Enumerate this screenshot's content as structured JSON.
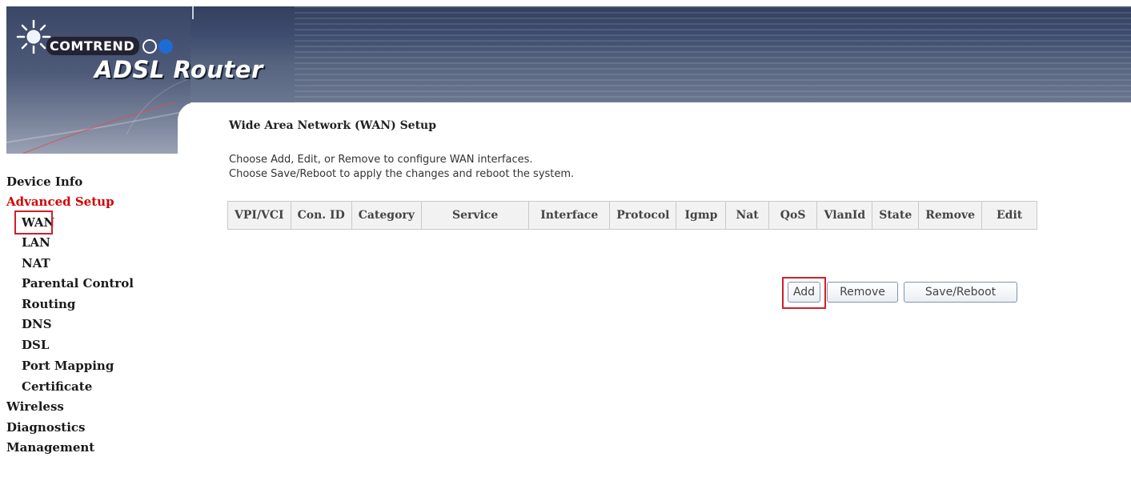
{
  "header": {
    "brand": "COMTREND",
    "product": "ADSL Router"
  },
  "sidebar": {
    "items": [
      {
        "label": "Device Info",
        "level": "top"
      },
      {
        "label": "Advanced Setup",
        "level": "top",
        "active": true
      },
      {
        "label": "WAN",
        "level": "sub",
        "selected": true
      },
      {
        "label": "LAN",
        "level": "sub"
      },
      {
        "label": "NAT",
        "level": "sub"
      },
      {
        "label": "Parental Control",
        "level": "sub"
      },
      {
        "label": "Routing",
        "level": "sub"
      },
      {
        "label": "DNS",
        "level": "sub"
      },
      {
        "label": "DSL",
        "level": "sub"
      },
      {
        "label": "Port Mapping",
        "level": "sub"
      },
      {
        "label": "Certificate",
        "level": "sub"
      },
      {
        "label": "Wireless",
        "level": "top"
      },
      {
        "label": "Diagnostics",
        "level": "top"
      },
      {
        "label": "Management",
        "level": "top"
      }
    ]
  },
  "main": {
    "title": "Wide Area Network (WAN) Setup",
    "instructions": [
      "Choose Add, Edit, or Remove to configure WAN interfaces.",
      "Choose Save/Reboot to apply the changes and reboot the system."
    ],
    "table": {
      "columns": [
        "VPI/VCI",
        "Con. ID",
        "Category",
        "Service",
        "Interface",
        "Protocol",
        "Igmp",
        "Nat",
        "QoS",
        "VlanId",
        "State",
        "Remove",
        "Edit"
      ],
      "rows": []
    },
    "buttons": {
      "add": "Add",
      "remove": "Remove",
      "save_reboot": "Save/Reboot"
    }
  },
  "colors": {
    "banner": "#3e4c6e",
    "active_nav": "#d30000",
    "highlight": "#d01f2b"
  }
}
